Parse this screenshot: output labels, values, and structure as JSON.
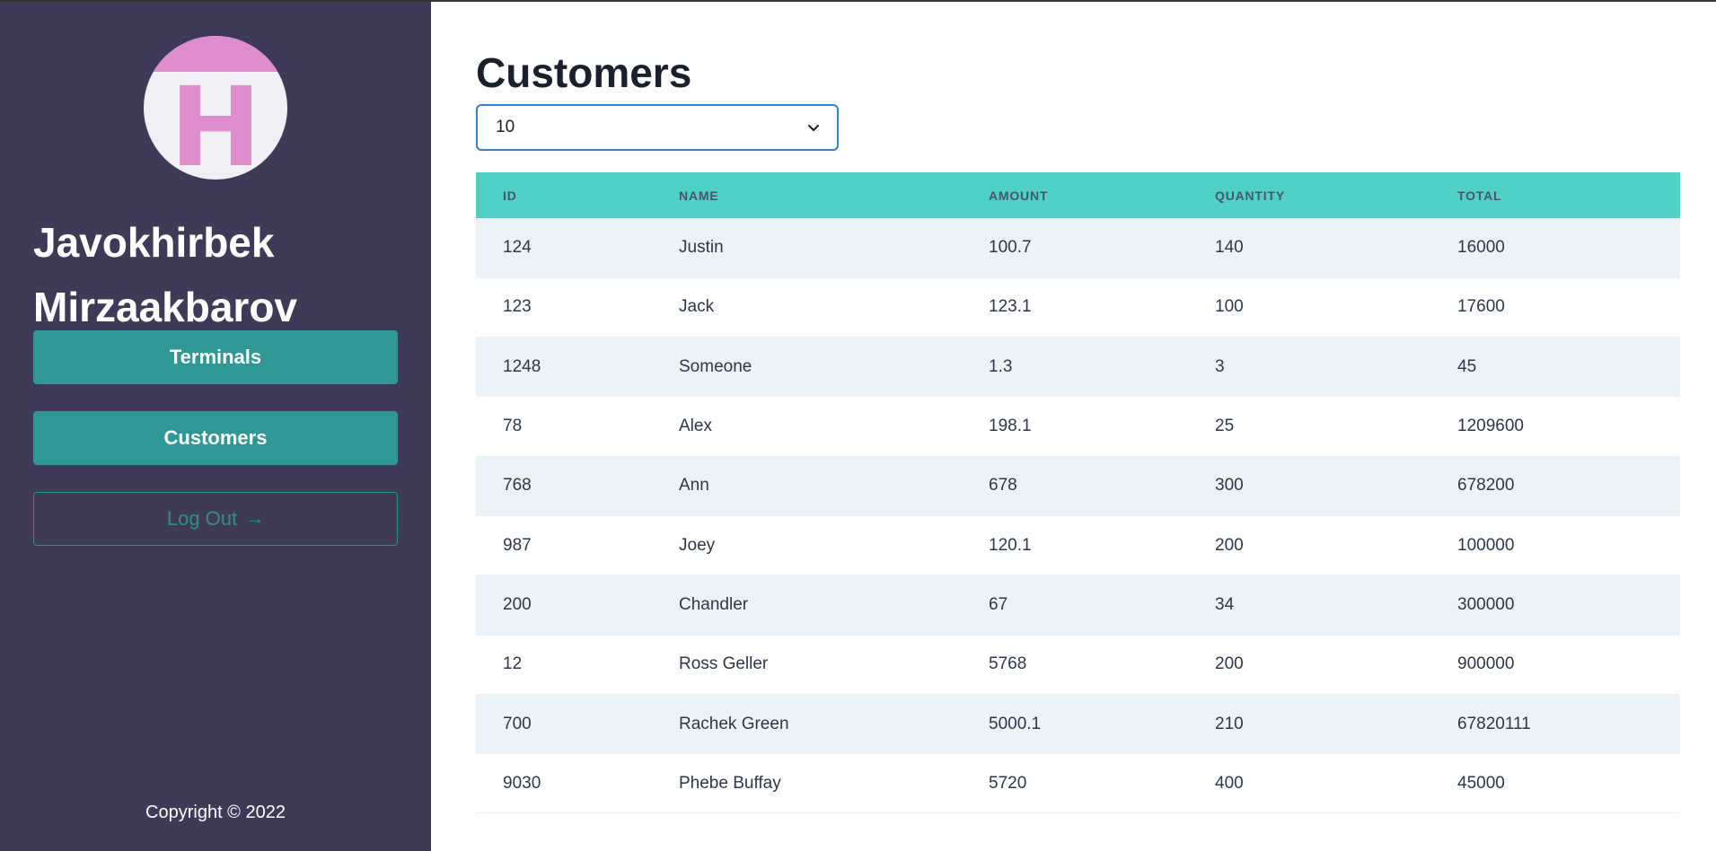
{
  "sidebar": {
    "avatar_letter": "H",
    "user_name": "Javokhirbek Mirzaakbarov",
    "nav": {
      "terminals_label": "Terminals",
      "customers_label": "Customers"
    },
    "logout_label": "Log Out",
    "copyright": "Copyright © 2022"
  },
  "main": {
    "title": "Customers",
    "page_size_select": {
      "value": "10"
    },
    "table": {
      "columns": [
        "ID",
        "NAME",
        "AMOUNT",
        "QUANTITY",
        "TOTAL"
      ],
      "rows": [
        [
          "124",
          "Justin",
          "100.7",
          "140",
          "16000"
        ],
        [
          "123",
          "Jack",
          "123.1",
          "100",
          "17600"
        ],
        [
          "1248",
          "Someone",
          "1.3",
          "3",
          "45"
        ],
        [
          "78",
          "Alex",
          "198.1",
          "25",
          "1209600"
        ],
        [
          "768",
          "Ann",
          "678",
          "300",
          "678200"
        ],
        [
          "987",
          "Joey",
          "120.1",
          "200",
          "100000"
        ],
        [
          "200",
          "Chandler",
          "67",
          "34",
          "300000"
        ],
        [
          "12",
          "Ross Geller",
          "5768",
          "200",
          "900000"
        ],
        [
          "700",
          "Rachek Green",
          "5000.1",
          "210",
          "67820111"
        ],
        [
          "9030",
          "Phebe Buffay",
          "5720",
          "400",
          "45000"
        ]
      ]
    }
  },
  "colors": {
    "sidebar_bg": "#403a59",
    "accent_teal": "#2f9794",
    "table_header": "#4fd1c5",
    "avatar_pink": "#df8ecd"
  }
}
